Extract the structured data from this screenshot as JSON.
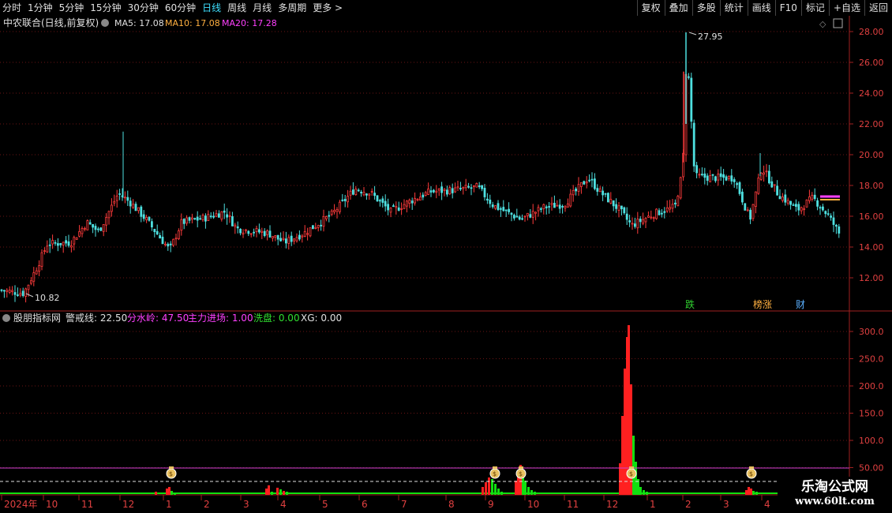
{
  "toolbar": {
    "periods": [
      "分时",
      "1分钟",
      "5分钟",
      "15分钟",
      "30分钟",
      "60分钟",
      "日线",
      "周线",
      "月线",
      "多周期",
      "更多 >"
    ],
    "active_index": 6,
    "actions": [
      "复权",
      "叠加",
      "多股",
      "统计",
      "画线",
      "F10",
      "标记",
      "+自选",
      "返回"
    ]
  },
  "main": {
    "title": "中农联合(日线,前复权)",
    "ma5": "MA5: 17.08",
    "ma10": "MA10: 17.08",
    "ma20": "MA20: 17.28",
    "high_label": "27.95",
    "low_label": "10.82",
    "y_ticks": [
      "28.00",
      "26.00",
      "24.00",
      "22.00",
      "20.00",
      "18.00",
      "16.00",
      "14.00",
      "12.00"
    ],
    "tags": [
      "跌",
      "榜涨",
      "财"
    ]
  },
  "indicator": {
    "name": "股朋指标网",
    "warn": "警戒线: 22.50",
    "ridge": "分水岭: 47.50",
    "main_in": "主力进场: 1.00",
    "wash": "洗盘: 0.00",
    "xg": "XG: 0.00",
    "y_ticks": [
      "300.0",
      "250.0",
      "200.0",
      "150.0",
      "100.0",
      "50.00"
    ]
  },
  "xaxis": {
    "labels": [
      "2024年",
      "10",
      "11",
      "12",
      "1",
      "2",
      "3",
      "4",
      "5",
      "6",
      "7",
      "8",
      "9",
      "10",
      "11",
      "12",
      "1",
      "2",
      "3",
      "4"
    ]
  },
  "watermark": {
    "title": "乐淘公式网",
    "url": "www.60lt.com"
  },
  "colors": {
    "up": "#ff3b3b",
    "down": "#4ee0e0",
    "ma10": "#ffb040",
    "ma20": "#ff40ff",
    "vol_red": "#ff2020",
    "vol_green": "#10e010"
  }
}
